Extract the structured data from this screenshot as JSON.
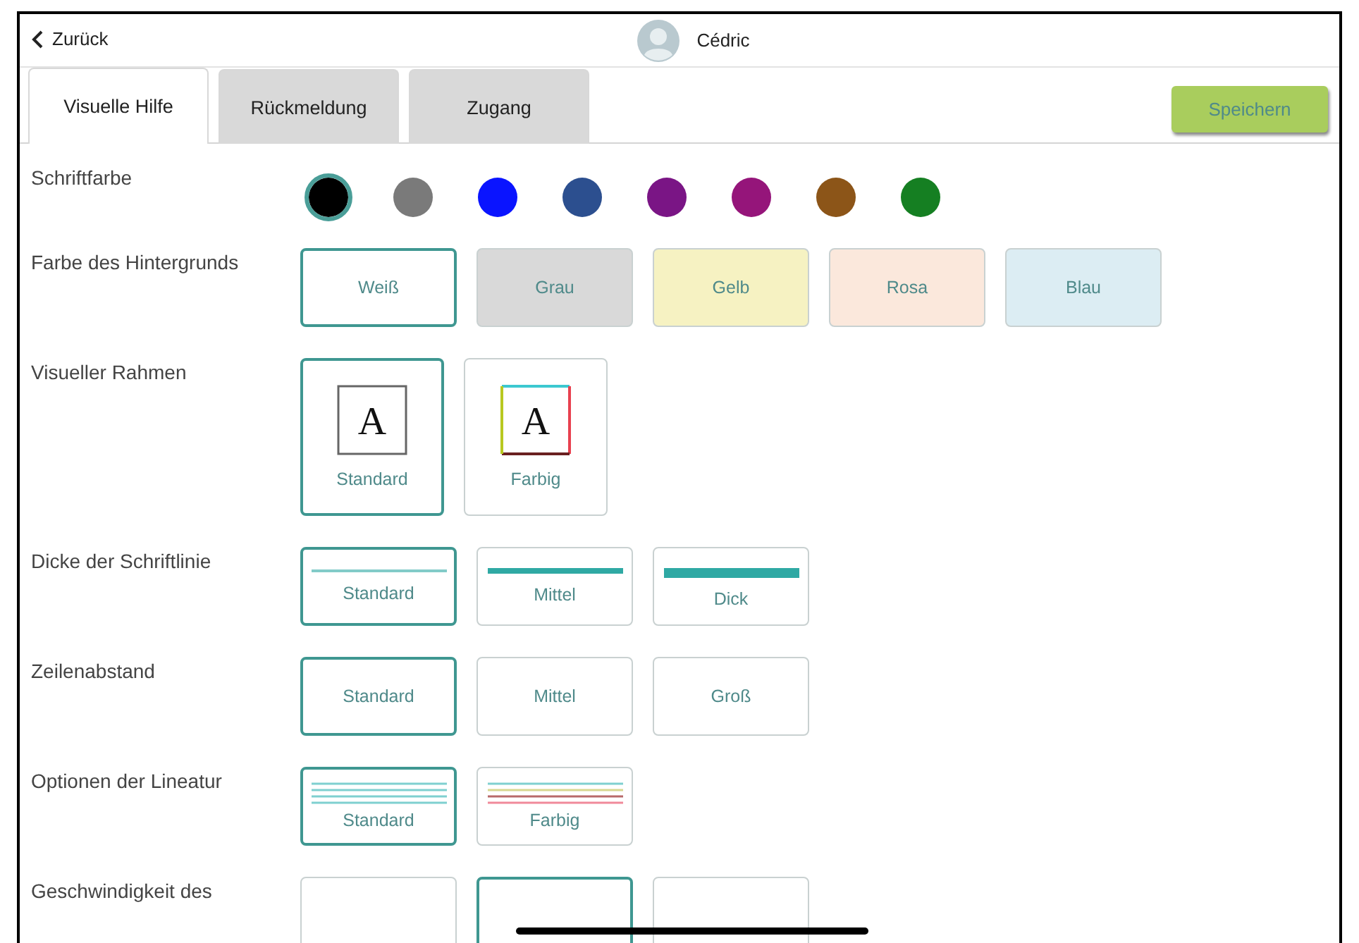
{
  "header": {
    "back": "Zurück",
    "user": "Cédric"
  },
  "tabs": [
    {
      "label": "Visuelle Hilfe",
      "selected": true
    },
    {
      "label": "Rückmeldung",
      "selected": false
    },
    {
      "label": "Zugang",
      "selected": false
    }
  ],
  "save_button": "Speichern",
  "settings": [
    {
      "label": "Schriftfarbe",
      "kind": "swatch",
      "options": [
        {
          "color": "#000000",
          "selected": true
        },
        {
          "color": "#7a7a7a",
          "selected": false
        },
        {
          "color": "#0a14ff",
          "selected": false
        },
        {
          "color": "#2c4f8f",
          "selected": false
        },
        {
          "color": "#7a1585",
          "selected": false
        },
        {
          "color": "#95157a",
          "selected": false
        },
        {
          "color": "#8c5518",
          "selected": false
        },
        {
          "color": "#157f22",
          "selected": false
        }
      ]
    },
    {
      "label": "Farbe des Hintergrunds",
      "kind": "fill",
      "options": [
        {
          "label": "Weiß",
          "color": "#ffffff",
          "selected": true
        },
        {
          "label": "Grau",
          "color": "#d9d9d9",
          "selected": false
        },
        {
          "label": "Gelb",
          "color": "#f6f2c2",
          "selected": false
        },
        {
          "label": "Rosa",
          "color": "#fbe8dc",
          "selected": false
        },
        {
          "label": "Blau",
          "color": "#dcedf3",
          "selected": false
        }
      ]
    },
    {
      "label": "Visueller Rahmen",
      "kind": "frame",
      "options": [
        {
          "label": "Standard",
          "glyph": "A",
          "selected": true
        },
        {
          "label": "Farbig",
          "glyph": "A",
          "selected": false
        }
      ]
    },
    {
      "label": "Dicke der Schriftlinie",
      "kind": "line",
      "options": [
        {
          "label": "Standard",
          "selected": true
        },
        {
          "label": "Mittel",
          "selected": false
        },
        {
          "label": "Dick",
          "selected": false
        }
      ]
    },
    {
      "label": "Zeilenabstand",
      "kind": "text",
      "options": [
        {
          "label": "Standard",
          "selected": true
        },
        {
          "label": "Mittel",
          "selected": false
        },
        {
          "label": "Groß",
          "selected": false
        }
      ]
    },
    {
      "label": "Optionen der Lineatur",
      "kind": "ruling",
      "options": [
        {
          "label": "Standard",
          "selected": true
        },
        {
          "label": "Farbig",
          "selected": false
        }
      ]
    },
    {
      "label": "Geschwindigkeit des",
      "kind": "text",
      "options": [
        {
          "selected": false
        },
        {
          "selected": true
        },
        {
          "selected": false
        }
      ]
    }
  ]
}
